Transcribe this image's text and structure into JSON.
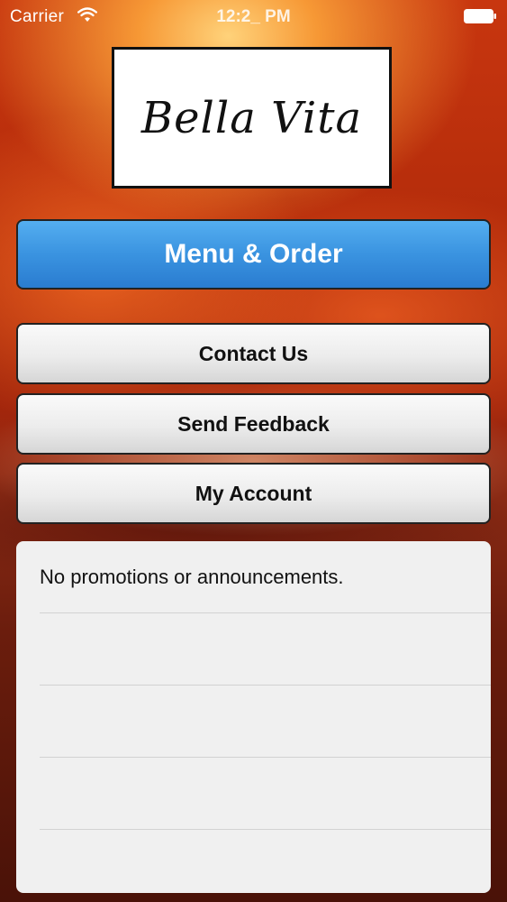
{
  "status_bar": {
    "carrier": "Carrier",
    "wifi_icon": "wifi-icon",
    "time": "12:2_ PM",
    "battery_icon": "battery-icon"
  },
  "logo": {
    "text": "Bella Vita"
  },
  "buttons": {
    "menu_order": "Menu & Order",
    "contact_us": "Contact Us",
    "send_feedback": "Send Feedback",
    "my_account": "My Account"
  },
  "promotions": {
    "items": [
      "No promotions or announcements.",
      "",
      "",
      "",
      ""
    ]
  },
  "colors": {
    "primary_button": "#3a93e0",
    "secondary_button": "#ececec",
    "panel_background": "#f0f0f0"
  }
}
